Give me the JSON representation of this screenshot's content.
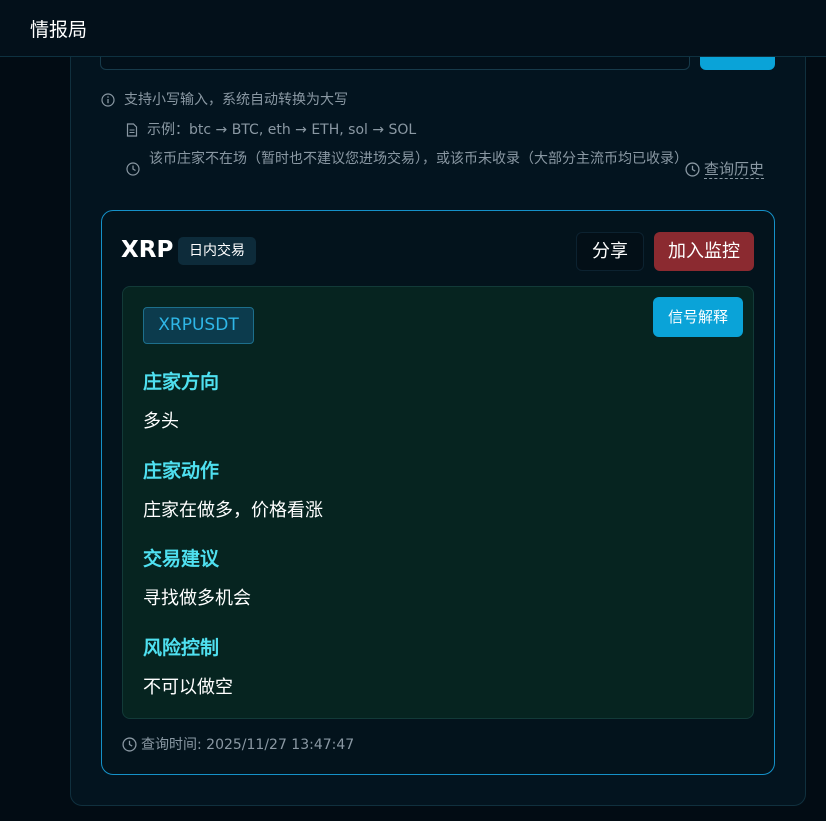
{
  "app": {
    "title": "情报局"
  },
  "hints": {
    "lowercase": "支持小写输入，系统自动转换为大写",
    "example": "示例：btc → BTC, eth → ETH, sol → SOL",
    "notice": "该币庄家不在场（暂时也不建议您进场交易），或该币未收录（大部分主流币均已收录）",
    "history_link": "查询历史"
  },
  "result": {
    "coin": "XRP",
    "mode_badge": "日内交易",
    "share_label": "分享",
    "monitor_label": "加入监控",
    "symbol": "XRPUSDT",
    "explain_label": "信号解释",
    "sections": [
      {
        "title": "庄家方向",
        "value": "多头"
      },
      {
        "title": "庄家动作",
        "value": "庄家在做多，价格看涨"
      },
      {
        "title": "交易建议",
        "value": "寻找做多机会"
      },
      {
        "title": "风险控制",
        "value": "不可以做空"
      }
    ],
    "query_time": "查询时间: 2025/11/27 13:47:47"
  },
  "colors": {
    "accent": "#0aa3d8",
    "danger": "#8b2a30",
    "section_title": "#4fe0f0",
    "card_border": "#1591c8"
  },
  "icons": {
    "lowercase_hint": "info-icon",
    "example_hint": "document-icon",
    "notice_hint": "clock-icon",
    "history": "clock-icon",
    "query_time": "clock-icon"
  }
}
